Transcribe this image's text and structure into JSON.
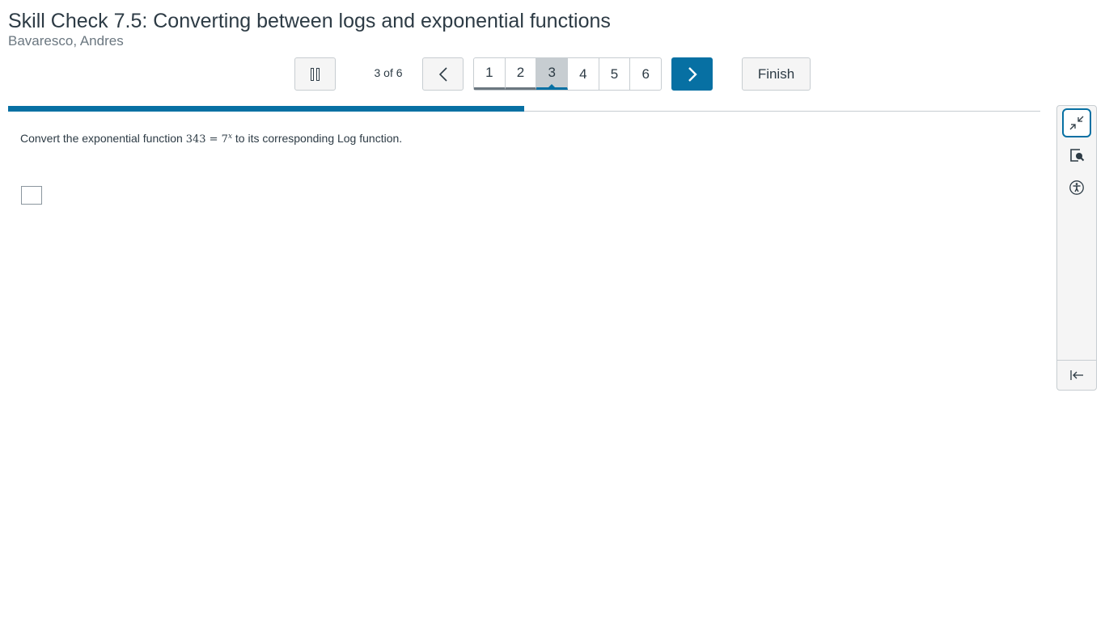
{
  "header": {
    "title": "Skill Check 7.5: Converting between logs and exponential functions",
    "student_name": "Bavaresco, Andres"
  },
  "toolbar": {
    "question_count": "3 of 6",
    "pages": [
      "1",
      "2",
      "3",
      "4",
      "5",
      "6"
    ],
    "current_page": 3,
    "finish_label": "Finish",
    "icons": {
      "pause": "pause-icon",
      "prev": "chevron-left-icon",
      "next": "chevron-right-icon"
    }
  },
  "progress": {
    "fraction": 0.5
  },
  "question": {
    "prompt_before": "Convert the exponential function ",
    "math_lhs": "343 = 7",
    "math_exp": "x",
    "prompt_after": " to its corresponding Log function."
  },
  "side_panel": {
    "icons": [
      "collapse-arrows-icon",
      "magnifier-icon",
      "accessibility-icon",
      "collapse-panel-icon"
    ]
  },
  "colors": {
    "accent": "#0770a3",
    "text": "#2d3b45",
    "muted": "#6b7780",
    "border": "#c7cdd1"
  }
}
